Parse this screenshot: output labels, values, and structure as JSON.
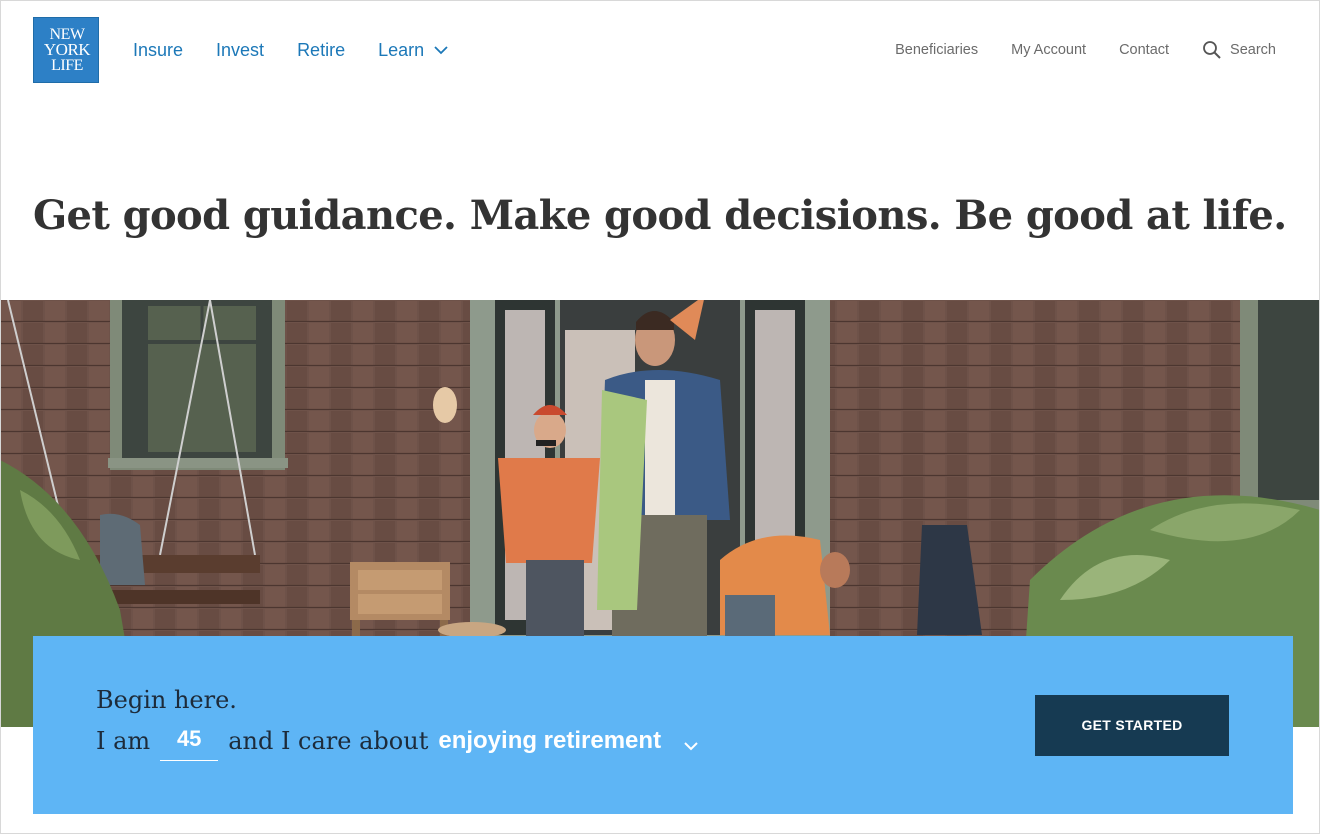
{
  "brand": {
    "logo_lines": [
      "NEW",
      "YORK",
      "LIFE"
    ],
    "logo_color": "#2d80c6"
  },
  "nav": {
    "primary": [
      "Insure",
      "Invest",
      "Retire",
      "Learn"
    ],
    "utility": [
      "Beneficiaries",
      "My Account",
      "Contact",
      "Search"
    ],
    "link_color": "#1c78b8"
  },
  "headline": "Get good guidance. Make good decisions. Be good at life.",
  "hero": {
    "icon": "family-porch-photo"
  },
  "form": {
    "intro": "Begin here.",
    "prefix": "I am",
    "age_value": "45",
    "middle": "and I care about",
    "topic_value": "enjoying retirement",
    "cta_label": "GET STARTED",
    "panel_color": "#5eb5f5",
    "cta_color": "#163a52"
  }
}
